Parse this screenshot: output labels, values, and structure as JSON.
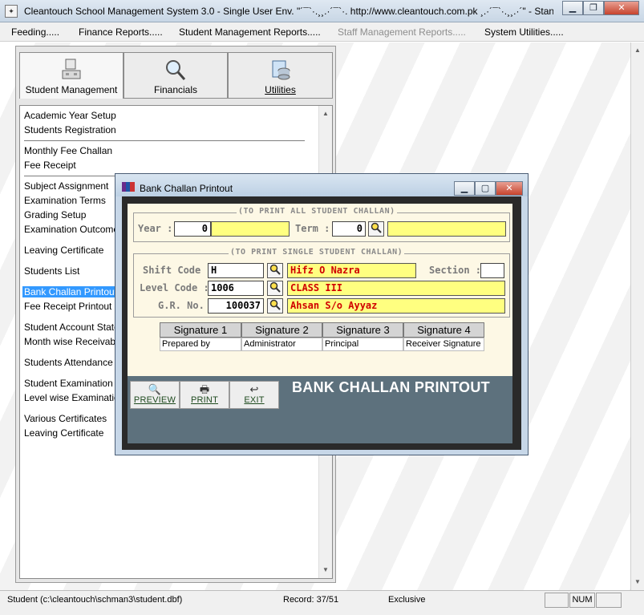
{
  "window": {
    "title": "Cleantouch School Management System 3.0 - Single User Env.    \"´¯`·.¸¸.·´¯`·. http://www.cleantouch.com.pk ¸.·´¯`·.¸¸.·´\" - Stan",
    "app_icon": "app-logo-icon"
  },
  "menu": {
    "items": [
      "Feeding.....",
      "Finance Reports.....",
      "Student Management Reports.....",
      "Staff Management Reports.....",
      "System Utilities....."
    ]
  },
  "tabs": [
    {
      "label": "Student Management",
      "icon": "computer-icon"
    },
    {
      "label": "Financials",
      "icon": "magnifier-icon"
    },
    {
      "label": "Utilities",
      "icon": "database-icon"
    }
  ],
  "list": {
    "items": [
      "Academic Year Setup",
      "Students Registration",
      "Monthly Fee Challan",
      "Fee Receipt",
      "Subject Assignment",
      "Examination Terms",
      "Grading Setup",
      "Examination Outcome",
      "Leaving Certificate",
      "Students List",
      "Bank Challan Printout",
      "Fee Receipt Printout",
      "Student Account Statement",
      "Month wise Receivable",
      "Students Attendance",
      "Student Examination",
      "Level wise Examination",
      "Various Certificates",
      "Leaving Certificate"
    ],
    "selected_index": 10
  },
  "dialog": {
    "title": "Bank Challan Printout",
    "group_all_title": "(TO PRINT ALL STUDENT CHALLAN)",
    "year_label": "Year :",
    "year_value": "0",
    "year_desc": "",
    "term_label": "Term :",
    "term_value": "0",
    "term_desc": "",
    "group_single_title": "(TO PRINT SINGLE STUDENT CHALLAN)",
    "shift_label": "Shift Code :",
    "shift_value": "H",
    "shift_desc": "Hifz O Nazra",
    "section_label": "Section :",
    "section_value": "",
    "level_label": "Level Code :",
    "level_value": "1006",
    "level_desc": "CLASS III",
    "gr_label": "G.R. No. :",
    "gr_value": "100037",
    "gr_desc": "Ahsan S/o Ayyaz",
    "signatures": [
      {
        "head": "Signature 1",
        "value": "Prepared by"
      },
      {
        "head": "Signature 2",
        "value": "Administrator"
      },
      {
        "head": "Signature 3",
        "value": "Principal"
      },
      {
        "head": "Signature 4",
        "value": "Receiver Signature"
      }
    ],
    "buttons": {
      "preview": "PREVIEW",
      "print": "PRINT",
      "exit": "EXIT"
    },
    "banner": "BANK CHALLAN PRINTOUT"
  },
  "status": {
    "path": "Student (c:\\cleantouch\\schman3\\student.dbf)",
    "record": "Record: 37/51",
    "mode": "Exclusive",
    "num": "NUM"
  }
}
